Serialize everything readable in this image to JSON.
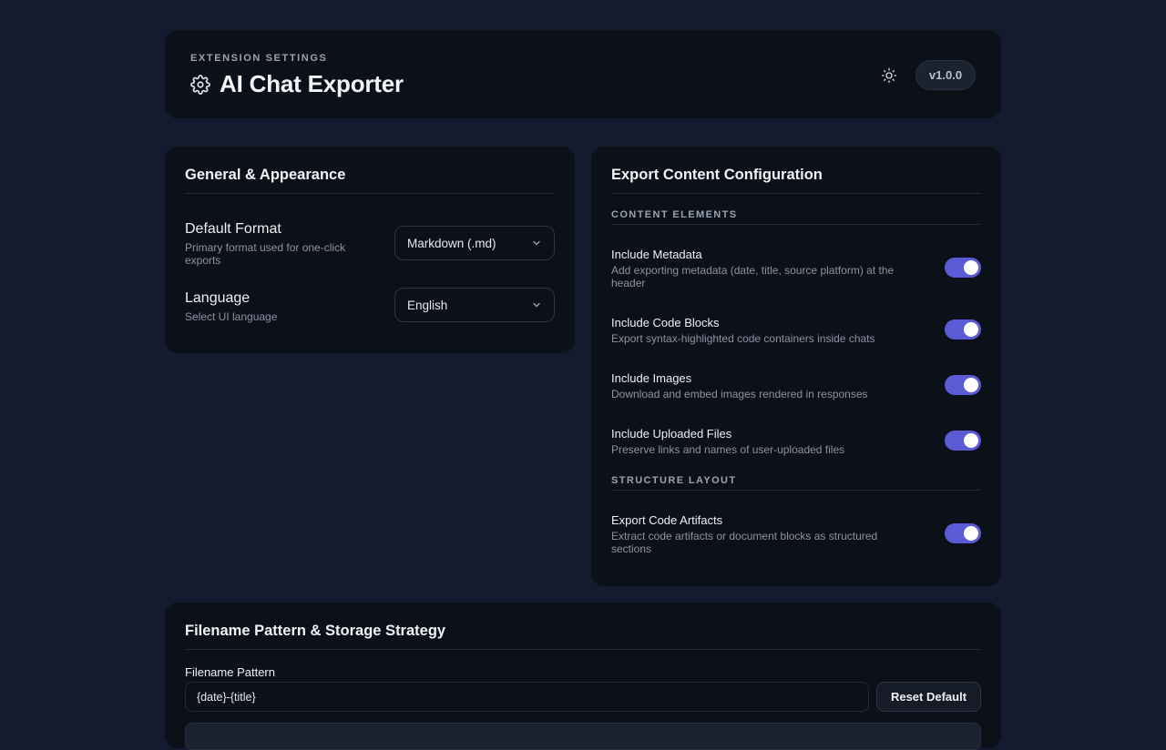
{
  "header": {
    "eyebrow": "EXTENSION SETTINGS",
    "title": "AI Chat Exporter",
    "version": "v1.0.0",
    "icons": {
      "title": "gear-icon",
      "theme": "sun-icon"
    }
  },
  "general": {
    "title": "General & Appearance",
    "settings": [
      {
        "label": "Default Format",
        "description": "Primary format used for one-click exports",
        "value": "Markdown (.md)"
      },
      {
        "label": "Language",
        "description": "Select UI language",
        "value": "English"
      }
    ]
  },
  "export": {
    "title": "Export Content Configuration",
    "sections": [
      {
        "label": "CONTENT ELEMENTS",
        "options": [
          {
            "label": "Include Metadata",
            "description": "Add exporting metadata (date, title, source platform) at the header",
            "enabled": true
          },
          {
            "label": "Include Code Blocks",
            "description": "Export syntax-highlighted code containers inside chats",
            "enabled": true
          },
          {
            "label": "Include Images",
            "description": "Download and embed images rendered in responses",
            "enabled": true
          },
          {
            "label": "Include Uploaded Files",
            "description": "Preserve links and names of user-uploaded files",
            "enabled": true
          }
        ]
      },
      {
        "label": "STRUCTURE LAYOUT",
        "options": [
          {
            "label": "Export Code Artifacts",
            "description": "Extract code artifacts or document blocks as structured sections",
            "enabled": true
          }
        ]
      }
    ]
  },
  "filename": {
    "title": "Filename Pattern & Storage Strategy",
    "field_label": "Filename Pattern",
    "pattern_value": "{date}-{title}",
    "reset_label": "Reset Default"
  },
  "colors": {
    "background": "#151b2e",
    "card": "#0c1019",
    "accent": "#5b5bd6"
  }
}
